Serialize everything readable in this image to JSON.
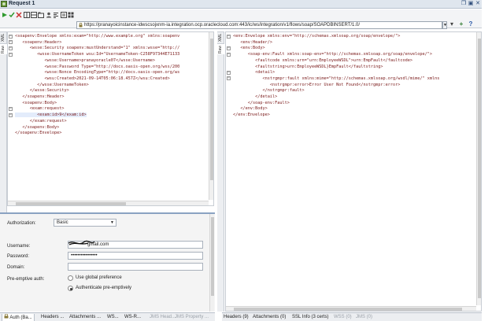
{
  "window": {
    "title": "Request 1"
  },
  "toolbar": {
    "endpoint": "https://pranayoicinstance-idwscsojxnm-ia.integration.ocp.oraclecloud.com:443/ic/ws/integration/v1/flows/soap/SOAPDBINSERT/1.0/",
    "add": "+",
    "help": "?"
  },
  "left_tabs": [
    "XML",
    "Raw"
  ],
  "right_tabs": [
    "XML",
    "Raw"
  ],
  "request_xml": [
    "<soapenv:Envelope xmlns:exam=\"http://www.example.org\" xmlns:soapenv",
    "   <soapenv:Header>",
    "      <wsse:Security soapenv:mustUnderstand=\"1\" xmlns:wsse=\"http://",
    "         <wsse:UsernameToken wsu:Id=\"UsernameToken-C258F97344E71133",
    "            <wsse:Username>pranayoracle07</wsse:Username>",
    "            <wsse:Password Type=\"http://docs.oasis-open.org/wss/200",
    "            <wsse:Nonce EncodingType=\"http://docs.oasis-open.org/ws",
    "            <wsu:Created>2021-09-14T05:06:18.457Z</wsu:Created>",
    "         </wsse:UsernameToken>",
    "      </wsse:Security>",
    "   </soapenv:Header>",
    "   <soapenv:Body>",
    "      <exam:request>",
    "         <exam:id>9</exam:id>",
    "      </exam:request>",
    "   </soapenv:Body>",
    "</soapenv:Envelope>"
  ],
  "response_xml": [
    "<env:Envelope xmlns:env=\"http://schemas.xmlsoap.org/soap/envelope/\">",
    "   <env:Header/>",
    "   <env:Body>",
    "      <soap-env:Fault xmlns:soap-env=\"http://schemas.xmlsoap.org/soap/envelope/\">",
    "         <faultcode xmlns:urn=\"urn:EmployeeWSDL\">urn:EmpFault</faultcode>",
    "         <faultstring>urn:EmployeeWSDL}EmpFault</faultstring>",
    "         <detail>",
    "            <nstrgmpr:fault xmlns:mime=\"http://schemas.xmlsoap.org/wsdl/mime/\" xmlns",
    "               <nstrgmpr:error>Error User Not Found</nstrgmpr:error>",
    "            </nstrgmpr:fault>",
    "         </detail>",
    "      </soap-env:Fault>",
    "   </env:Body>",
    "</env:Envelope>"
  ],
  "auth": {
    "authorization_label": "Authorization:",
    "authorization_value": "Basic",
    "username_label": "Username:",
    "username_value": "gmail.com",
    "password_label": "Password:",
    "password_value": "••••••••••••••••",
    "domain_label": "Domain:",
    "domain_value": "",
    "preemptive_label": "Pre-emptive auth:",
    "option_global": "Use global preference",
    "option_preemptive": "Authenticate pre-emptively",
    "selected_option": "preemptive"
  },
  "bottom_tabs_left": [
    "Auth (Ba...",
    "Headers ...",
    "Attachments ...",
    "WS...",
    "WS-R...",
    "JMS Head...",
    "JMS Property ..."
  ],
  "bottom_tabs_right": [
    "Headers (9)",
    "Attachments (0)",
    "SSL Info (3 certs)",
    "WSS (0)",
    "JMS (0)"
  ],
  "colors": {
    "tag": "#7a1a1a",
    "attr": "#c01515",
    "value": "#1a36c8",
    "accent": "#8aa2c2"
  }
}
